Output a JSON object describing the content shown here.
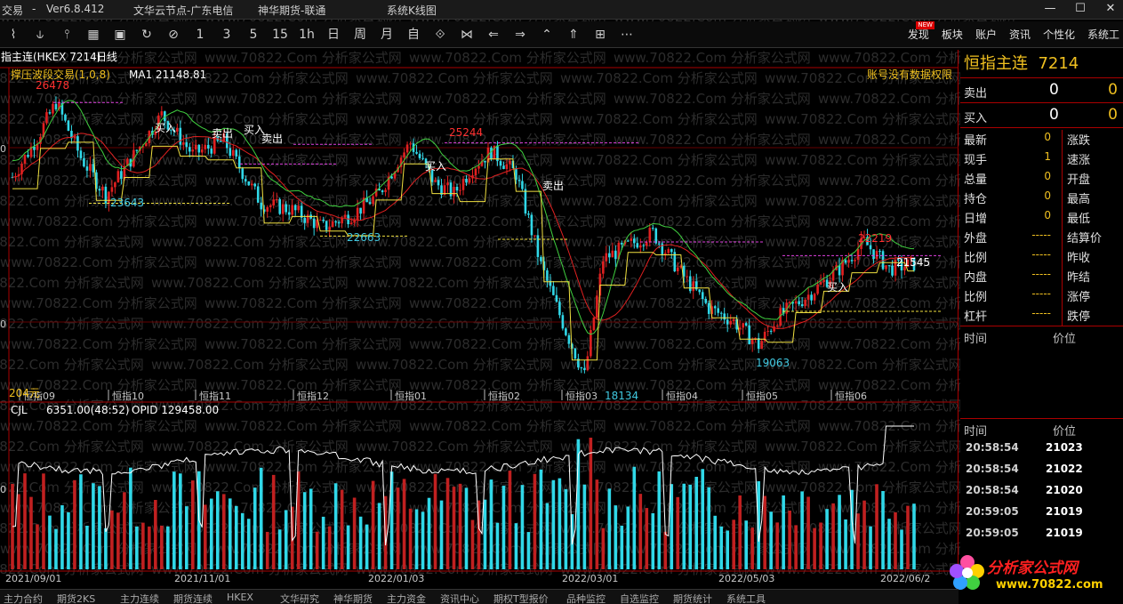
{
  "titlebar": {
    "app": "交易",
    "sep": "-",
    "version": "Ver6.8.412",
    "node": "文华云节点-广东电信",
    "broker": "神华期货-联通",
    "view": "系统K线图"
  },
  "toolbar": {
    "icons": [
      "line-icon",
      "candle-icon",
      "bar-icon",
      "grid-icon",
      "save-icon",
      "refresh-icon",
      "zoom-icon"
    ],
    "periods": [
      "1",
      "3",
      "5",
      "15",
      "1h",
      "日",
      "周",
      "月",
      "自"
    ],
    "menu": [
      "发现",
      "板块",
      "账户",
      "资讯",
      "个性化",
      "系统工"
    ],
    "new_badge": "NEW"
  },
  "chart": {
    "instrument_label": "指主连(HKEX 7214)",
    "period_label": "日线",
    "indicator": "撑压波段交易(1,0,8)",
    "ma_label": "MA1 21148.81",
    "no_permission": "账号没有数据权限",
    "left_axis_price1": "0",
    "left_axis_price2": "0",
    "left_axis_price3": "0",
    "left_bottom_label": "204元",
    "price_labels": [
      {
        "text": "26478",
        "color": "#ff3030"
      },
      {
        "text": "23643",
        "color": "#40c8e0"
      },
      {
        "text": "22663",
        "color": "#40c8e0"
      },
      {
        "text": "25244",
        "color": "#ff3030"
      },
      {
        "text": "18134",
        "color": "#40c8e0"
      },
      {
        "text": "22219",
        "color": "#ff3030"
      },
      {
        "text": "21545",
        "color": "#ffffff"
      },
      {
        "text": "19063",
        "color": "#40c8e0"
      }
    ],
    "signals": [
      "买入",
      "卖出",
      "买入",
      "卖出",
      "买入",
      "卖出",
      "买入"
    ],
    "month_labels": [
      "恒指09",
      "恒指10",
      "恒指11",
      "恒指12",
      "恒指01",
      "恒指02",
      "恒指03",
      "恒指04",
      "恒指05",
      "恒指06"
    ],
    "volume_label": "CJL",
    "volume_value": "6351.00(48:52)",
    "opid": "OPID 129458.00",
    "date_labels": [
      "2021/09/01",
      "2021/11/01",
      "2022/01/03",
      "2022/03/01",
      "2022/05/03",
      "2022/06/2"
    ]
  },
  "right_panel": {
    "title": "恒指主连",
    "code": "7214",
    "sell": {
      "label": "卖出",
      "v1": "0",
      "v2": "0"
    },
    "buy": {
      "label": "买入",
      "v1": "0",
      "v2": "0"
    },
    "grid": [
      {
        "l1": "最新",
        "v": "0",
        "l2": "涨跌"
      },
      {
        "l1": "现手",
        "v": "1",
        "l2": "速涨"
      },
      {
        "l1": "总量",
        "v": "0",
        "l2": "开盘"
      },
      {
        "l1": "持仓",
        "v": "0",
        "l2": "最高"
      },
      {
        "l1": "日增",
        "v": "0",
        "l2": "最低"
      },
      {
        "l1": "外盘",
        "v": "-----",
        "l2": "结算价"
      },
      {
        "l1": "比例",
        "v": "-----",
        "l2": "昨收"
      },
      {
        "l1": "内盘",
        "v": "-----",
        "l2": "昨结"
      },
      {
        "l1": "比例",
        "v": "-----",
        "l2": "涨停"
      },
      {
        "l1": "杠杆",
        "v": "-----",
        "l2": "跌停"
      }
    ],
    "header1": {
      "time": "时间",
      "price": "价位"
    },
    "header2": {
      "time": "时间",
      "price": "价位"
    },
    "ticks": [
      {
        "time": "20:58:54",
        "price": "21023"
      },
      {
        "time": "20:58:54",
        "price": "21022"
      },
      {
        "time": "20:58:54",
        "price": "21020"
      },
      {
        "time": "20:59:05",
        "price": "21019"
      },
      {
        "time": "20:59:05",
        "price": "21019"
      }
    ]
  },
  "logo": {
    "top": "分析家公式网",
    "bottom": "www.70822.com"
  },
  "watermark": "www.70822.Com 分析家公式网",
  "bottombar": [
    "主力合约",
    "期货2KS",
    "主力连续",
    "期货连续",
    "HKEX",
    "文华研究",
    "神华期货",
    "主力资金",
    "资讯中心",
    "期权T型报价",
    "品种监控",
    "自选监控",
    "期货统计",
    "系统工具"
  ]
}
